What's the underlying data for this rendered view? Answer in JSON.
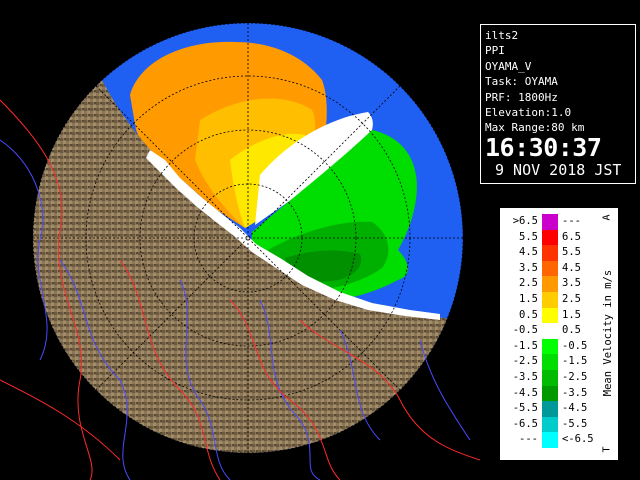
{
  "info": {
    "system": "ilts2",
    "product": "PPI",
    "station_id": "OYAMA_V",
    "task": "Task: OYAMA",
    "prf": "PRF: 1800Hz",
    "elevation": "Elevation:1.0",
    "max_range": "Max Range:80 km",
    "time": "16:30:37",
    "date": "9 NOV 2018 JST"
  },
  "legend": {
    "title": "Mean Velocity in m/s",
    "corner_top": "A",
    "corner_bottom": "T",
    "rows": [
      {
        "left": ">6.5",
        "right": "---",
        "color": "#cc00cc"
      },
      {
        "left": "5.5",
        "right": "6.5",
        "color": "#ff0000"
      },
      {
        "left": "4.5",
        "right": "5.5",
        "color": "#ff3300"
      },
      {
        "left": "3.5",
        "right": "4.5",
        "color": "#ff6600"
      },
      {
        "left": "2.5",
        "right": "3.5",
        "color": "#ff9900"
      },
      {
        "left": "1.5",
        "right": "2.5",
        "color": "#ffcc00"
      },
      {
        "left": "0.5",
        "right": "1.5",
        "color": "#ffff00"
      },
      {
        "left": "-0.5",
        "right": "0.5",
        "color": "#ffffff"
      },
      {
        "left": "-1.5",
        "right": "-0.5",
        "color": "#00ff00"
      },
      {
        "left": "-2.5",
        "right": "-1.5",
        "color": "#00dd00"
      },
      {
        "left": "-3.5",
        "right": "-2.5",
        "color": "#00bb00"
      },
      {
        "left": "-4.5",
        "right": "-3.5",
        "color": "#009900"
      },
      {
        "left": "-5.5",
        "right": "-4.5",
        "color": "#009999"
      },
      {
        "left": "-6.5",
        "right": "-5.5",
        "color": "#00cccc"
      },
      {
        "left": "---",
        "right": "<-6.5",
        "color": "#00ffff"
      }
    ]
  },
  "colors": {
    "background": "#000000",
    "radar_range_disk": "#1f5ff2",
    "land": "#8a7658",
    "rivers": "#4444ff",
    "boundaries": "#ff2222"
  }
}
